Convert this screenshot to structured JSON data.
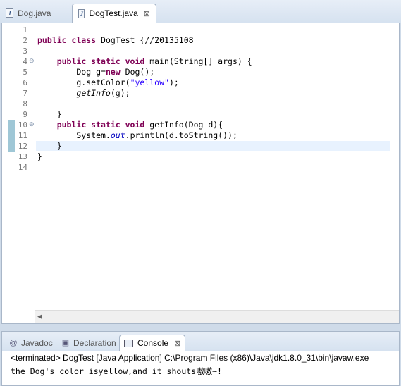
{
  "editor_tabs": [
    {
      "label": "Dog.java",
      "active": false
    },
    {
      "label": "DogTest.java",
      "active": true,
      "close": "⊠"
    }
  ],
  "line_numbers": [
    "1",
    "2",
    "3",
    "4",
    "5",
    "6",
    "7",
    "8",
    "9",
    "10",
    "11",
    "12",
    "13",
    "14"
  ],
  "code_lines": [
    {
      "n": "1",
      "parts": []
    },
    {
      "n": "2",
      "parts": [
        {
          "t": "public class",
          "c": "kw"
        },
        {
          "t": " DogTest {//20135108",
          "c": ""
        }
      ]
    },
    {
      "n": "3",
      "parts": []
    },
    {
      "n": "4",
      "parts": [
        {
          "t": "    ",
          "c": ""
        },
        {
          "t": "public static void",
          "c": "kw"
        },
        {
          "t": " main(String[] args) {",
          "c": ""
        }
      ]
    },
    {
      "n": "5",
      "parts": [
        {
          "t": "        Dog g=",
          "c": ""
        },
        {
          "t": "new",
          "c": "kw"
        },
        {
          "t": " Dog();",
          "c": ""
        }
      ]
    },
    {
      "n": "6",
      "parts": [
        {
          "t": "        g.setColor(",
          "c": ""
        },
        {
          "t": "\"yellow\"",
          "c": "str"
        },
        {
          "t": ");",
          "c": ""
        }
      ]
    },
    {
      "n": "7",
      "parts": [
        {
          "t": "        ",
          "c": ""
        },
        {
          "t": "getInfo",
          "c": "it"
        },
        {
          "t": "(g);",
          "c": ""
        }
      ]
    },
    {
      "n": "8",
      "parts": []
    },
    {
      "n": "9",
      "parts": [
        {
          "t": "    }",
          "c": ""
        }
      ]
    },
    {
      "n": "10",
      "parts": [
        {
          "t": "    ",
          "c": ""
        },
        {
          "t": "public static void",
          "c": "kw"
        },
        {
          "t": " getInfo(Dog d){",
          "c": ""
        }
      ]
    },
    {
      "n": "11",
      "parts": [
        {
          "t": "        System.",
          "c": ""
        },
        {
          "t": "out",
          "c": "fld"
        },
        {
          "t": ".println(d.toString());",
          "c": ""
        }
      ]
    },
    {
      "n": "12",
      "parts": [
        {
          "t": "    }",
          "c": ""
        }
      ]
    },
    {
      "n": "13",
      "parts": [
        {
          "t": "}",
          "c": ""
        }
      ]
    },
    {
      "n": "14",
      "parts": []
    }
  ],
  "bottom_tabs": [
    {
      "label": "Javadoc",
      "icon": "@"
    },
    {
      "label": "Declaration",
      "icon": "declaration-icon"
    },
    {
      "label": "Console",
      "icon": "console-icon",
      "active": true,
      "close": "⊠"
    }
  ],
  "console": {
    "terminated": "<terminated> DogTest [Java Application] C:\\Program Files (x86)\\Java\\jdk1.8.0_31\\bin\\javaw.exe",
    "output": "the Dog's color isyellow,and it shouts嗷嗷~!"
  },
  "colors": {
    "keyword": "#7f0055",
    "string": "#2a00ff",
    "field": "#0000c0",
    "current_line": "#e8f2fe"
  }
}
